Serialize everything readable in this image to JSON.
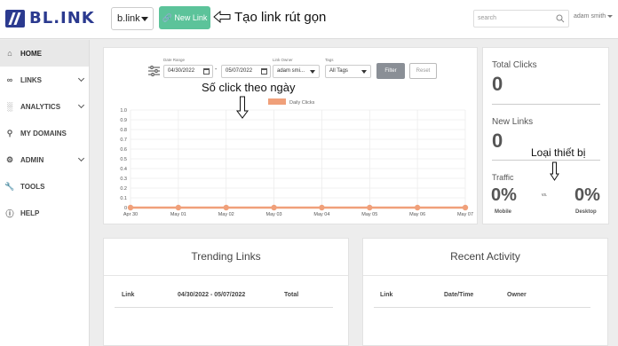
{
  "brand": {
    "name": "BL.INK"
  },
  "header": {
    "domain_selected": "b.link",
    "new_link_label": "New Link",
    "search_placeholder": "search",
    "user_name": "adam smith"
  },
  "annotations": {
    "new_link_note": "Tạo link rút gọn",
    "daily_clicks_note": "Số click theo ngày",
    "device_note": "Loại thiết bị"
  },
  "sidebar": {
    "items": [
      {
        "label": "HOME",
        "icon": "home-icon",
        "active": true
      },
      {
        "label": "LINKS",
        "icon": "link-icon",
        "has_submenu": true
      },
      {
        "label": "ANALYTICS",
        "icon": "bar-chart-icon",
        "has_submenu": true
      },
      {
        "label": "MY DOMAINS",
        "icon": "location-pin-icon"
      },
      {
        "label": "ADMIN",
        "icon": "gear-icon",
        "has_submenu": true
      },
      {
        "label": "TOOLS",
        "icon": "wrench-icon"
      },
      {
        "label": "HELP",
        "icon": "help-circle-icon"
      }
    ]
  },
  "filters": {
    "date_range_label": "Date Range",
    "date_from": "04/30/2022",
    "date_sep": "-",
    "date_to": "05/07/2022",
    "link_owner_label": "Link Owner",
    "link_owner_value": "adam smi...",
    "tags_label": "Tags",
    "tags_value": "All Tags",
    "filter_button": "Filter",
    "reset_button": "Reset"
  },
  "chart_data": {
    "type": "line",
    "x": [
      "Apr 30",
      "May 01",
      "May 02",
      "May 03",
      "May 04",
      "May 05",
      "May 06",
      "May 07"
    ],
    "series": [
      {
        "name": "Daily Clicks",
        "values": [
          0,
          0,
          0,
          0,
          0,
          0,
          0,
          0
        ],
        "color": "#f0a07a"
      }
    ],
    "ylim": [
      0,
      1.0
    ],
    "yticks": [
      "0",
      "0.1",
      "0.2",
      "0.3",
      "0.4",
      "0.5",
      "0.6",
      "0.7",
      "0.8",
      "0.9",
      "1.0"
    ],
    "grid": true,
    "legend": "top"
  },
  "stats": {
    "total_clicks_label": "Total Clicks",
    "total_clicks": "0",
    "new_links_label": "New Links",
    "new_links": "0",
    "traffic_label": "Traffic",
    "mobile_pct": "0%",
    "mobile_label": "Mobile",
    "vs_label": "vs.",
    "desktop_pct": "0%",
    "desktop_label": "Desktop"
  },
  "trending": {
    "title": "Trending Links",
    "columns": [
      "Link",
      "04/30/2022 - 05/07/2022",
      "Total"
    ]
  },
  "recent": {
    "title": "Recent Activity",
    "columns": [
      "Link",
      "Date/Time",
      "Owner"
    ]
  },
  "colors": {
    "brand": "#2b3a8f",
    "new_link_button": "#5cc39a",
    "filter_button": "#8a8f96",
    "series": "#f0a07a"
  }
}
